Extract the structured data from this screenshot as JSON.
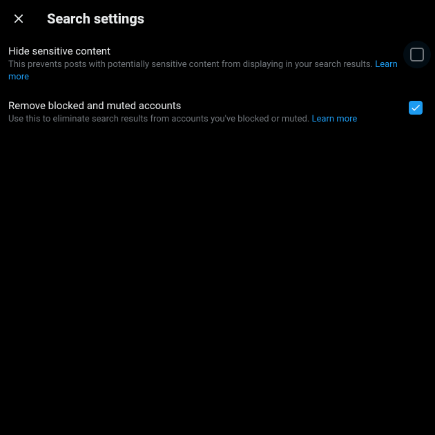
{
  "header": {
    "title": "Search settings"
  },
  "settings": {
    "hide_sensitive": {
      "title": "Hide sensitive content",
      "description": "This prevents posts with potentially sensitive content from displaying in your search results.",
      "learn_more": "Learn more",
      "checked": false
    },
    "remove_blocked": {
      "title": "Remove blocked and muted accounts",
      "description": "Use this to eliminate search results from accounts you've blocked or muted.",
      "learn_more": "Learn more",
      "checked": true
    }
  },
  "colors": {
    "accent": "#1d9bf0",
    "background": "#000000",
    "text": "#e7e9ea",
    "secondary_text": "#71767b"
  }
}
